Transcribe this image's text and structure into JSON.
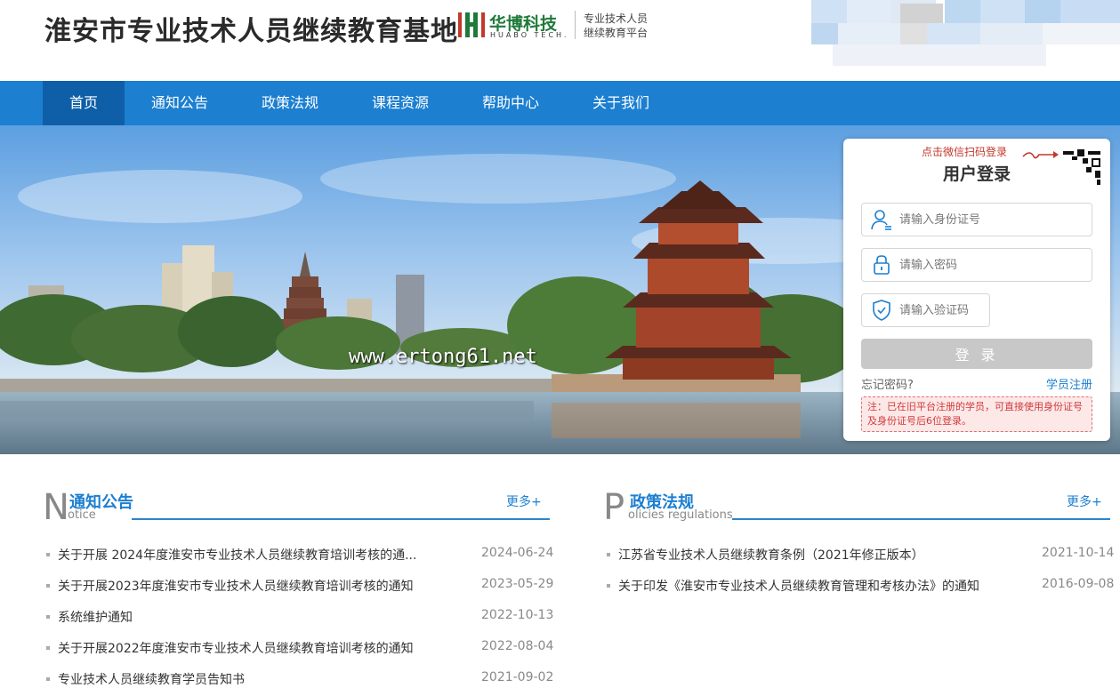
{
  "header": {
    "site_title": "淮安市专业技术人员继续教育基地",
    "logo_cn": "华博科技",
    "logo_en": "HUABO TECH.",
    "logo_sub1": "专业技术人员",
    "logo_sub2": "继续教育平台"
  },
  "nav": {
    "items": [
      {
        "label": "首页"
      },
      {
        "label": "通知公告"
      },
      {
        "label": "政策法规"
      },
      {
        "label": "课程资源"
      },
      {
        "label": "帮助中心"
      },
      {
        "label": "关于我们"
      }
    ]
  },
  "banner": {
    "watermark": "www.ertong61.net"
  },
  "login": {
    "wechat_tip": "点击微信扫码登录",
    "title": "用户登录",
    "id_placeholder": "请输入身份证号",
    "password_placeholder": "请输入密码",
    "captcha_placeholder": "请输入验证码",
    "login_button": "登 录",
    "forgot": "忘记密码?",
    "register": "学员注册",
    "notice": "注：已在旧平台注册的学员，可直接使用身份证号及身份证号后6位登录。"
  },
  "notices": {
    "letter": "N",
    "title": "通知公告",
    "en": "otice",
    "more": "更多+",
    "items": [
      {
        "title": "关于开展 2024年度淮安市专业技术人员继续教育培训考核的通...",
        "date": "2024-06-24"
      },
      {
        "title": "关于开展2023年度淮安市专业技术人员继续教育培训考核的通知",
        "date": "2023-05-29"
      },
      {
        "title": "系统维护通知",
        "date": "2022-10-13"
      },
      {
        "title": "关于开展2022年度淮安市专业技术人员继续教育培训考核的通知",
        "date": "2022-08-04"
      },
      {
        "title": "专业技术人员继续教育学员告知书",
        "date": "2021-09-02"
      }
    ]
  },
  "policies": {
    "letter": "P",
    "title": "政策法规",
    "en": "olicies regulations",
    "more": "更多+",
    "items": [
      {
        "title": "江苏省专业技术人员继续教育条例（2021年修正版本）",
        "date": "2021-10-14"
      },
      {
        "title": "关于印发《淮安市专业技术人员继续教育管理和考核办法》的通知",
        "date": "2016-09-08"
      }
    ]
  },
  "colors": {
    "nav": "#1c7fd0",
    "nav_active": "#0f5fa8",
    "accent": "#1c7fd0",
    "alert": "#d03a3a"
  }
}
